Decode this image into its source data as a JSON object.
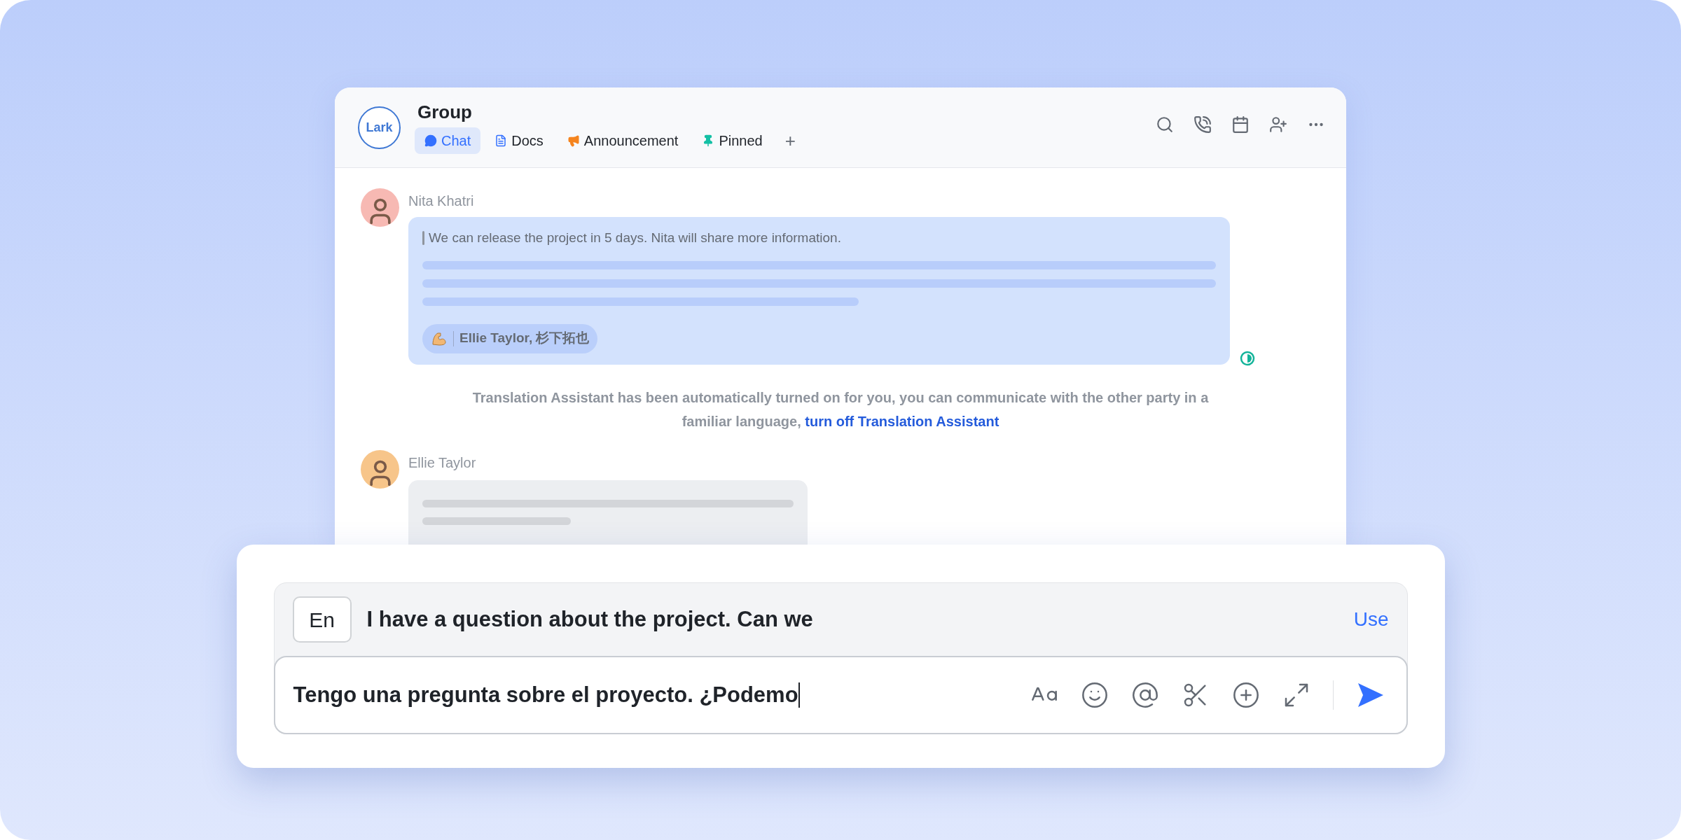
{
  "window": {
    "logo": "Lark",
    "title": "Group",
    "tabs": [
      {
        "kind": "chat",
        "label": "Chat",
        "selected": true
      },
      {
        "kind": "docs",
        "label": "Docs",
        "selected": false
      },
      {
        "kind": "announcement",
        "label": "Announcement",
        "selected": false
      },
      {
        "kind": "pinned",
        "label": "Pinned",
        "selected": false
      }
    ],
    "add_tab": "+"
  },
  "messages": [
    {
      "kind": "translated",
      "sender": "Nita Khatri",
      "text": "We can release the project in 5 days. Nita will share more information.",
      "reaction_names": "Ellie Taylor, 杉下拓也"
    },
    {
      "kind": "system",
      "text": "Translation Assistant has been automatically turned on for you, you can communicate with the other party in a familiar language, ",
      "link": "turn off Translation Assistant"
    },
    {
      "kind": "loading",
      "sender": "Ellie Taylor"
    }
  ],
  "composer": {
    "language": "En",
    "translation": "I have a question about the project. Can we",
    "use_label": "Use",
    "value": "Tengo una pregunta sobre el proyecto. ¿Podemo"
  }
}
